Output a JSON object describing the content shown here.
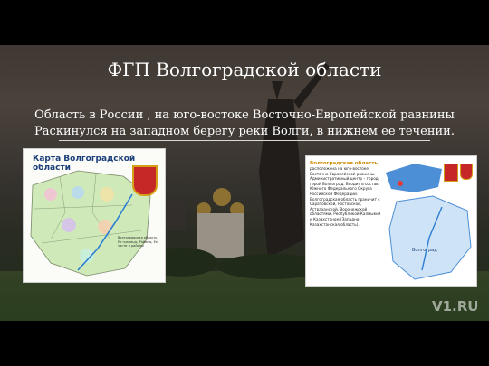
{
  "slide": {
    "title": "ФГП Волгоградской области",
    "line1": "Область в России , на юго-востоке Восточно-Европейской равнины",
    "line2": "Раскинулся на западном берегу реки Волги, в нижнем ее течении."
  },
  "map_left": {
    "title": "Карта Волгоградской области",
    "legend": "Волгоградская область, Ее границы, Районы, Ее части и районы"
  },
  "map_right": {
    "heading": "Волгоградская область",
    "text": "расположена на юго-востоке Восточно-Европейской равнины. Административный центр – город-герой Волгоград. Входит в состав Южного Федерального Округа Российской Федерации. Волгоградская область граничит с Саратовской, Ростовской, Астраханской, Воронежской областями, Республикой Калмыкия и Казахстаном (Западно-Казахстанская область).",
    "city_label": "Волгоград"
  },
  "watermark": "V1.RU",
  "colors": {
    "text": "#ffffff",
    "map_title": "#1b3f7a",
    "heading": "#d08a00"
  }
}
